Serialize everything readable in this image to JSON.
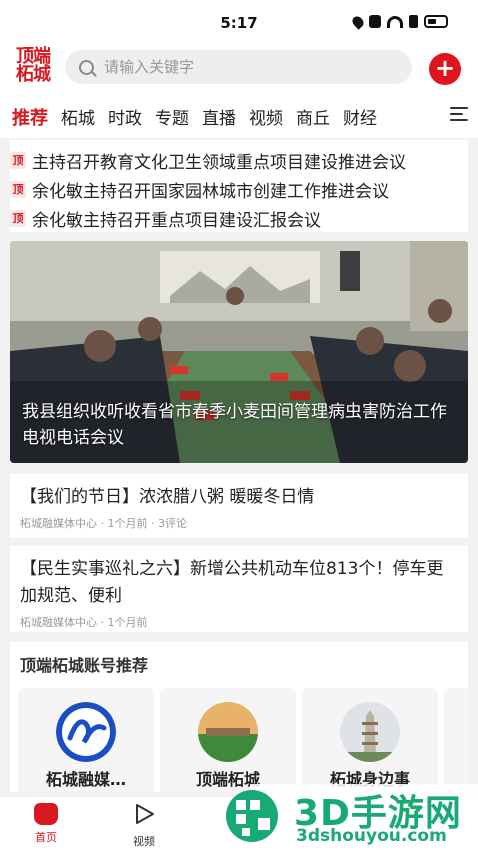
{
  "status_bar": {
    "time": "5:17"
  },
  "header": {
    "logo_text": "顶端\n柘城",
    "search_placeholder": "请输入关键字"
  },
  "tabs": [
    "推荐",
    "柘城",
    "时政",
    "专题",
    "直播",
    "视频",
    "商丘",
    "财经"
  ],
  "headlines": {
    "tag": "顶",
    "items": [
      "主持召开教育文化卫生领域重点项目建设推进会议",
      "余化敏主持召开国家园林城市创建工作推进会议",
      "余化敏主持召开重点项目建设汇报会议"
    ]
  },
  "featured": {
    "caption": "我县组织收听收看省市春季小麦田间管理病虫害防治工作电视电话会议"
  },
  "cards": [
    {
      "title": "【我们的节日】浓浓腊八粥 暖暖冬日情",
      "meta": "柘城融媒体中心 · 1个月前 · 3评论"
    },
    {
      "title": "【民生实事巡礼之六】新增公共机动车位813个！停车更加规范、便利",
      "meta": "柘城融媒体中心 · 1个月前"
    }
  ],
  "accounts": {
    "title": "顶端柘城账号推荐",
    "items": [
      {
        "name": "柘城融媒…"
      },
      {
        "name": "顶端柘城"
      },
      {
        "name": "柘城身边事"
      }
    ]
  },
  "bottom_nav": [
    {
      "label": "首页"
    },
    {
      "label": "视频"
    }
  ],
  "watermark": {
    "title": "3D手游网",
    "url": "3dshouyou.com"
  },
  "colors": {
    "accent": "#d71820",
    "watermark": "#19a974"
  }
}
